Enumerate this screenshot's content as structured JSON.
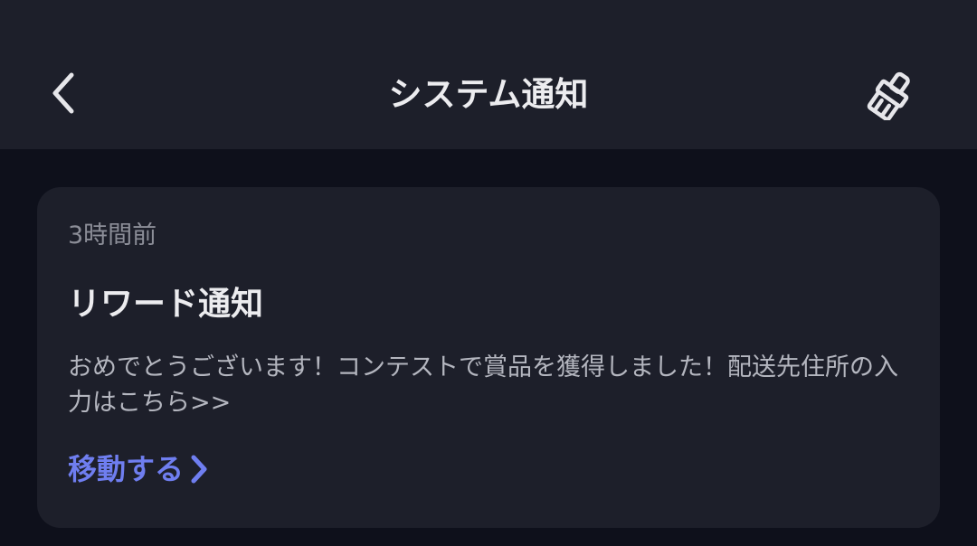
{
  "header": {
    "title": "システム通知",
    "back_icon": "chevron-left-icon",
    "clear_icon": "broom-icon"
  },
  "notifications": [
    {
      "time": "3時間前",
      "title": "リワード通知",
      "body": "おめでとうございます！コンテストで賞品を獲得しました！配送先住所の入力はこちら>>",
      "link_label": "移動する",
      "link_icon": "chevron-right-icon"
    }
  ],
  "colors": {
    "background": "#0e101b",
    "surface": "#1d1f2a",
    "title_text": "#ececef",
    "secondary_text": "#8c8e98",
    "body_text": "#b4b6bf",
    "accent": "#6f7ef0"
  }
}
